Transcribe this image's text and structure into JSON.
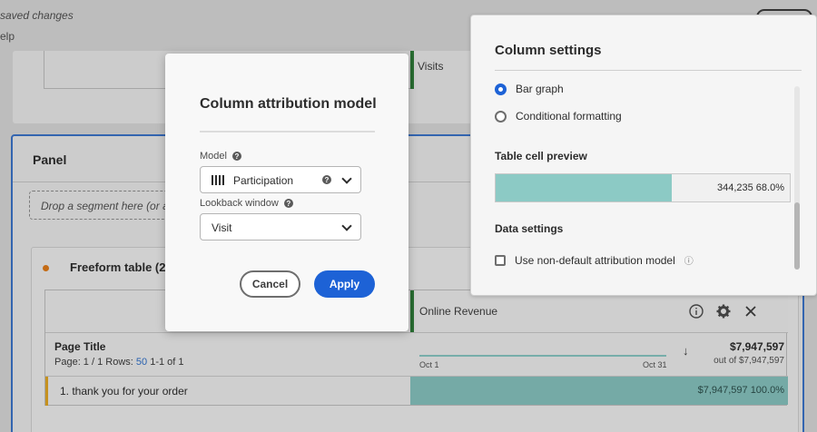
{
  "header": {
    "saved_status": "saved changes",
    "menu_help": "elp"
  },
  "top_table": {
    "column_label": "Visits"
  },
  "panel": {
    "title": "Panel",
    "drop_zone_text": "Drop a segment here (or an"
  },
  "freeform": {
    "title": "Freeform table (2",
    "column": {
      "label": "Online Revenue"
    },
    "dimension": {
      "title": "Page Title",
      "page_info_prefix": "Page: 1 / 1  Rows:",
      "rows_value": "50",
      "range": "1-1 of 1"
    },
    "sparkline": {
      "start_label": "Oct 1",
      "end_label": "Oct 31"
    },
    "sort_icon": "arrow-down-icon",
    "total": {
      "value": "$7,947,597",
      "sub": "out of $7,947,597"
    },
    "rows": [
      {
        "label": "1. thank you for your order",
        "value_text": "$7,947,597  100.0%",
        "fraction": 1.0
      }
    ]
  },
  "column_settings": {
    "title": "Column settings",
    "options": {
      "bar_graph": "Bar graph",
      "conditional_formatting": "Conditional formatting"
    },
    "preview_heading": "Table cell preview",
    "preview_value": "344,235  68.0%",
    "preview_fraction": 0.6,
    "data_settings_heading": "Data settings",
    "attribution_checkbox_label": "Use non-default attribution model"
  },
  "modal": {
    "title": "Column attribution model",
    "model_label": "Model",
    "model_value": "Participation",
    "lookback_label": "Lookback window",
    "lookback_value": "Visit",
    "cancel_label": "Cancel",
    "apply_label": "Apply"
  },
  "colors": {
    "accent": "#1d62d6",
    "bar_fill": "#86c2bd",
    "metric_green": "#2f7d39",
    "panel_border": "#3b73c9"
  }
}
